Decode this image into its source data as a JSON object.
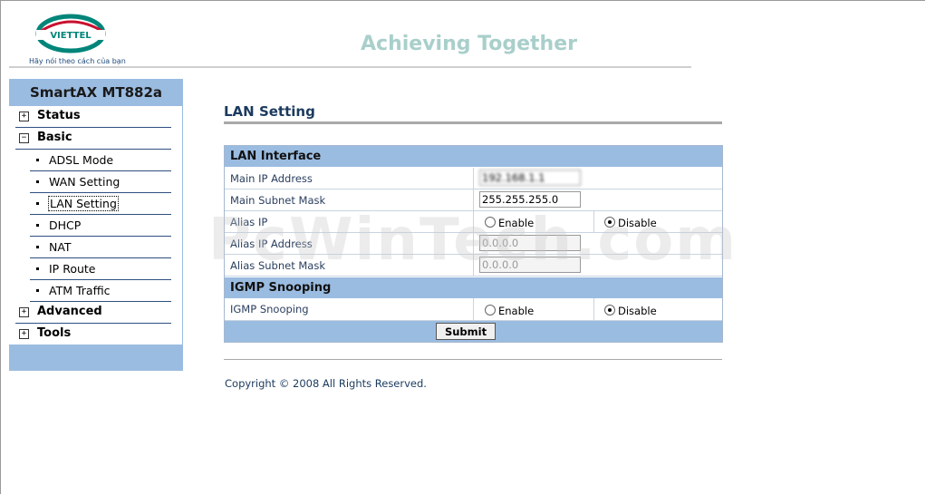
{
  "header": {
    "logo_text": "VIETTEL",
    "slogan_sub": "Hãy nói theo cách của bạn",
    "title": "Achieving Together"
  },
  "sidebar": {
    "title": "SmartAX MT882a",
    "items": [
      {
        "label": "Status",
        "expander": "+"
      },
      {
        "label": "Basic",
        "expander": "−"
      },
      {
        "label": "ADSL Mode"
      },
      {
        "label": "WAN Setting"
      },
      {
        "label": "LAN Setting"
      },
      {
        "label": "DHCP"
      },
      {
        "label": "NAT"
      },
      {
        "label": "IP Route"
      },
      {
        "label": "ATM Traffic"
      },
      {
        "label": "Advanced",
        "expander": "+"
      },
      {
        "label": "Tools",
        "expander": "+"
      }
    ]
  },
  "main": {
    "title": "LAN Setting",
    "lan_interface": {
      "heading": "LAN Interface",
      "main_ip_label": "Main IP Address",
      "main_ip_value": "192.168.1.1",
      "subnet_label": "Main Subnet Mask",
      "subnet_value": "255.255.255.0",
      "alias_ip_label": "Alias IP",
      "enable_label": "Enable",
      "disable_label": "Disable",
      "alias_ip_state": "disable",
      "alias_addr_label": "Alias IP Address",
      "alias_addr_value": "0.0.0.0",
      "alias_mask_label": "Alias Subnet Mask",
      "alias_mask_value": "0.0.0.0"
    },
    "igmp": {
      "heading": "IGMP Snooping",
      "label": "IGMP Snooping",
      "enable_label": "Enable",
      "disable_label": "Disable",
      "state": "disable"
    },
    "submit_label": "Submit",
    "copyright": "Copyright © 2008 All Rights Reserved."
  },
  "watermark": "PcWinTech.com",
  "colors": {
    "accent": "#9bbce1",
    "title_blue": "#1b3a5e",
    "header_title": "#a9cfcb",
    "logo_red": "#c8102e",
    "logo_teal": "#00857a"
  }
}
